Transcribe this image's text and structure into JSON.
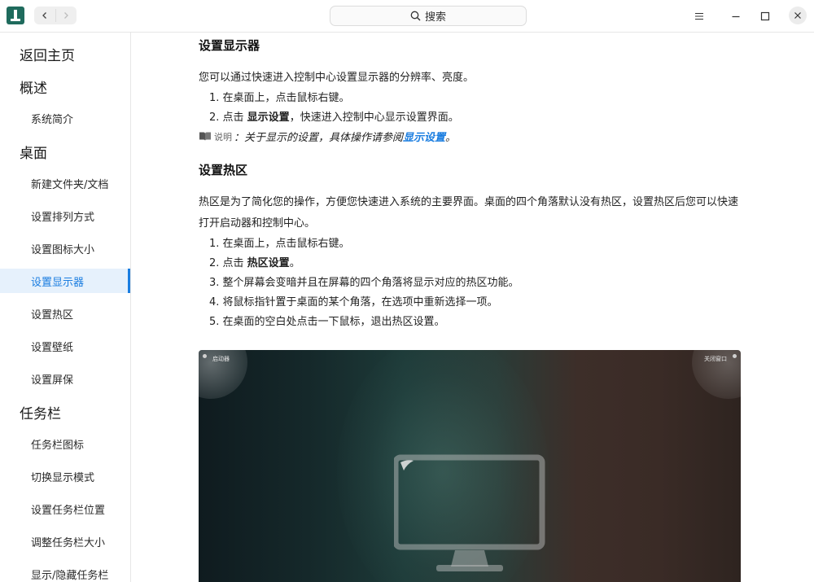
{
  "titlebar": {
    "search_placeholder": "搜索"
  },
  "sidebar": {
    "items": [
      {
        "label": "返回主页",
        "level": "top"
      },
      {
        "label": "概述",
        "level": "top"
      },
      {
        "label": "系统简介",
        "level": "sub"
      },
      {
        "label": "桌面",
        "level": "top"
      },
      {
        "label": "新建文件夹/文档",
        "level": "sub"
      },
      {
        "label": "设置排列方式",
        "level": "sub"
      },
      {
        "label": "设置图标大小",
        "level": "sub"
      },
      {
        "label": "设置显示器",
        "level": "sub",
        "active": true
      },
      {
        "label": "设置热区",
        "level": "sub"
      },
      {
        "label": "设置壁纸",
        "level": "sub"
      },
      {
        "label": "设置屏保",
        "level": "sub"
      },
      {
        "label": "任务栏",
        "level": "top"
      },
      {
        "label": "任务栏图标",
        "level": "sub"
      },
      {
        "label": "切换显示模式",
        "level": "sub"
      },
      {
        "label": "设置任务栏位置",
        "level": "sub"
      },
      {
        "label": "调整任务栏大小",
        "level": "sub"
      },
      {
        "label": "显示/隐藏任务栏",
        "level": "sub"
      }
    ]
  },
  "content": {
    "display": {
      "heading": "设置显示器",
      "intro": "您可以通过快速进入控制中心设置显示器的分辨率、亮度。",
      "step1": "1. 在桌面上，点击鼠标右键。",
      "step2_prefix": "2. 点击 ",
      "step2_bold": "显示设置",
      "step2_suffix": "，快速进入控制中心显示设置界面。",
      "note_label": "说明",
      "note_text": "：关于显示的设置，具体操作请参阅 ",
      "note_link": "显示设置",
      "note_end": "。"
    },
    "hotzone": {
      "heading": "设置热区",
      "intro_line1": "热区是为了简化您的操作，方便您快速进入系统的主要界面。桌面的四个角落默认没有热区，设置热区后您可以快速",
      "intro_line2": "打开启动器和控制中心。",
      "step1": "1. 在桌面上，点击鼠标右键。",
      "step2_prefix": "2. 点击 ",
      "step2_bold": "热区设置",
      "step2_suffix": "。",
      "step3": "3. 整个屏幕会变暗并且在屏幕的四个角落将显示对应的热区功能。",
      "step4": "4. 将鼠标指针置于桌面的某个角落，在选项中重新选择一项。",
      "step5": "5. 在桌面的空白处点击一下鼠标，退出热区设置。"
    },
    "screenshot": {
      "corner_top_left": "启动器",
      "corner_top_right": "关闭窗口"
    }
  }
}
